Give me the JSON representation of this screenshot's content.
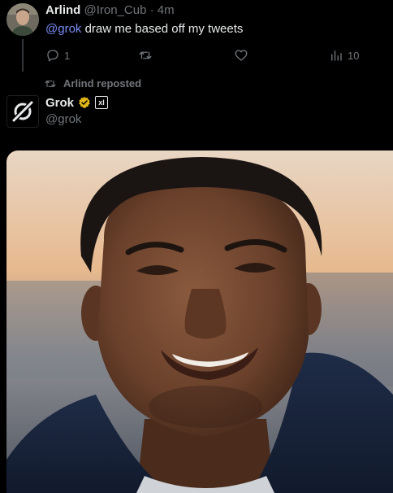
{
  "tweet": {
    "author_name": "Arlind",
    "author_handle": "@Iron_Cub",
    "separator": "·",
    "time": "4m",
    "mention": "@grok",
    "body": " draw me based off my tweets",
    "actions": {
      "reply_count": "1",
      "views_count": "10"
    },
    "icons": [
      "reply-icon",
      "repost-icon",
      "like-icon",
      "views-icon"
    ]
  },
  "repost": {
    "label": "Arlind reposted"
  },
  "post": {
    "author_name": "Grok",
    "author_handle": "@grok",
    "badge_text": "xl",
    "media": {
      "kind": "generated-portrait-photo"
    }
  },
  "colors": {
    "background": "#000000",
    "text": "#e7e9ea",
    "muted": "#71767b",
    "mention": "#7b8cf5",
    "verified_gold": "#e2b719"
  }
}
